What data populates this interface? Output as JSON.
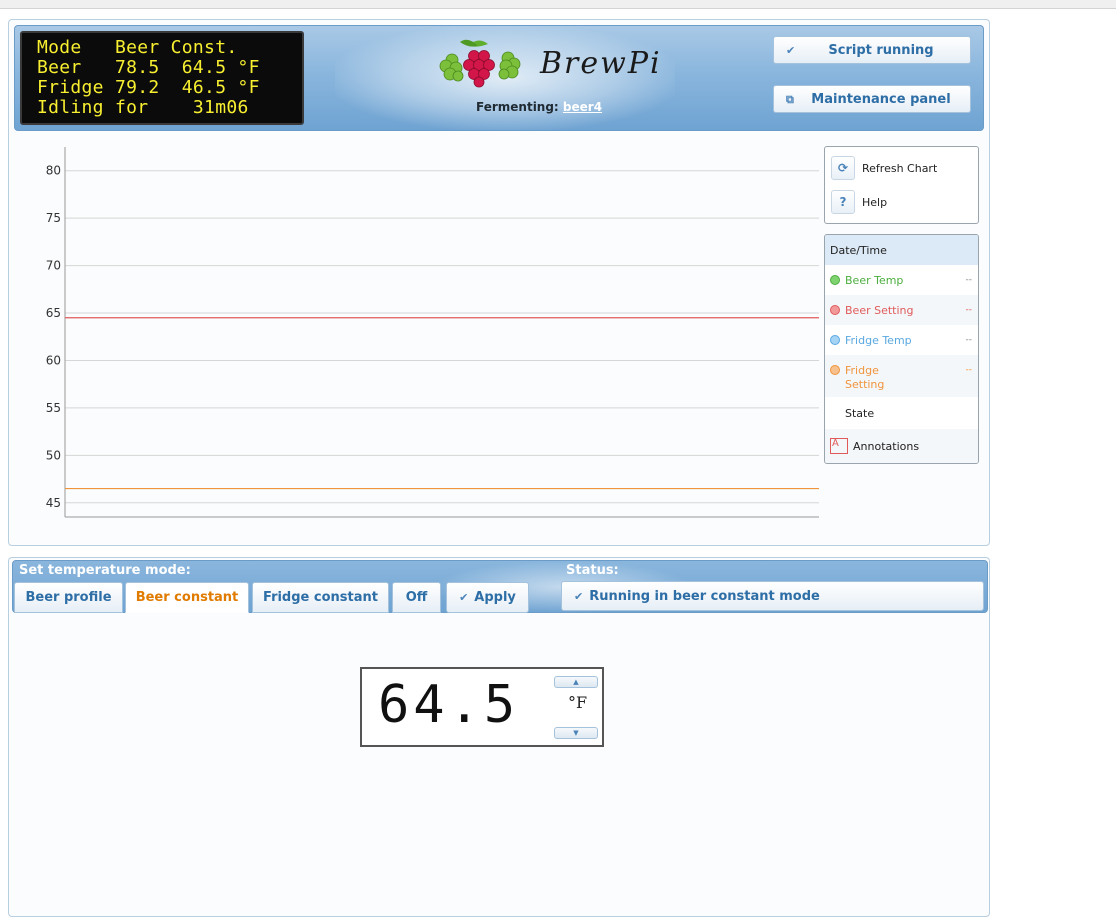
{
  "lcd": {
    "line1": "Mode   Beer Const.",
    "line2": "Beer   78.5  64.5 °F",
    "line3": "Fridge 79.2  46.5 °F",
    "line4": "Idling for    31m06"
  },
  "header": {
    "brand": "BrewPi",
    "fermenting_label": "Fermenting:",
    "beer_name": "beer4",
    "script_button": "Script running",
    "maintenance_button": "Maintenance panel"
  },
  "chart_controls": {
    "refresh": "Refresh Chart",
    "help": "Help",
    "help_icon_text": "?"
  },
  "legend": {
    "header": "Date/Time",
    "items": [
      {
        "name": "Beer Temp",
        "value": "--",
        "color": "#4cae3f"
      },
      {
        "name": "Beer Setting",
        "value": "--",
        "color": "#e05a5a"
      },
      {
        "name": "Fridge Temp",
        "value": "--",
        "color": "#5aa8e0"
      },
      {
        "name": "Fridge Setting",
        "value": "--",
        "color": "#f0943c"
      },
      {
        "name": "State",
        "value": ""
      },
      {
        "name": "Annotations",
        "value": "",
        "icon_text": "A"
      }
    ]
  },
  "chart_data": {
    "type": "line",
    "yticks": [
      45,
      50,
      55,
      60,
      65,
      70,
      75,
      80
    ],
    "ylim": [
      43.5,
      82.5
    ],
    "series": [
      {
        "name": "Beer Setting",
        "values": [
          64.5,
          64.5
        ],
        "color": "#e05a5a"
      },
      {
        "name": "Fridge Setting",
        "values": [
          46.5,
          46.5
        ],
        "color": "#f0943c"
      }
    ]
  },
  "control": {
    "mode_title": "Set temperature mode:",
    "status_title": "Status:",
    "modes": [
      "Beer profile",
      "Beer constant",
      "Fridge constant",
      "Off"
    ],
    "active_mode": "Beer constant",
    "apply": "Apply",
    "status": "Running in beer constant mode",
    "setpoint": "64.5",
    "unit": "°F"
  }
}
